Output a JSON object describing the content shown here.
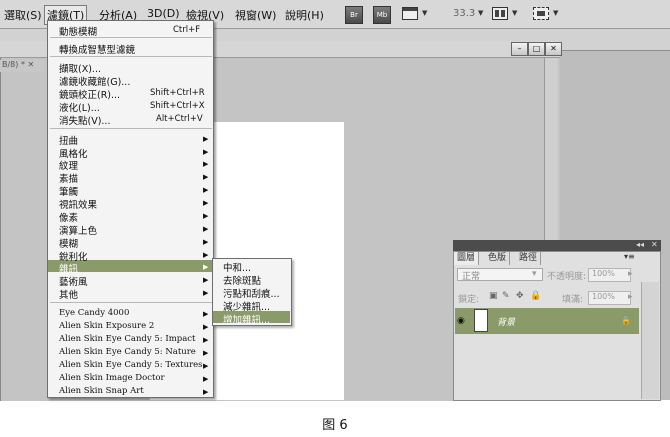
{
  "menubar": {
    "items": [
      "選取(S)",
      "濾鏡(T)",
      "分析(A)",
      "3D(D)",
      "檢視(V)",
      "視窗(W)",
      "說明(H)"
    ],
    "buttons": [
      "Br",
      "Mb"
    ],
    "zoom": "33.3"
  },
  "document": {
    "tab_label": "B/8) * ✕"
  },
  "filter_menu": {
    "last_filter": {
      "label": "動態模糊",
      "shortcut": "Ctrl+F"
    },
    "convert": "轉換成智慧型濾鏡",
    "group1": [
      {
        "label": "擷取(X)...",
        "shortcut": ""
      },
      {
        "label": "濾鏡收藏館(G)...",
        "shortcut": ""
      },
      {
        "label": "鏡頭校正(R)...",
        "shortcut": "Shift+Ctrl+R"
      },
      {
        "label": "液化(L)...",
        "shortcut": "Shift+Ctrl+X"
      },
      {
        "label": "消失點(V)...",
        "shortcut": "Alt+Ctrl+V"
      }
    ],
    "group2": [
      "扭曲",
      "風格化",
      "紋理",
      "素描",
      "筆觸",
      "視訊效果",
      "像素",
      "演算上色",
      "模糊",
      "銳利化",
      "雜訊",
      "藝術風",
      "其他"
    ],
    "group3": [
      "Eye Candy 4000",
      "Alien Skin Exposure 2",
      "Alien Skin Eye Candy 5: Impact",
      "Alien Skin Eye Candy 5: Nature",
      "Alien Skin Eye Candy 5: Textures",
      "Alien Skin Image Doctor",
      "Alien Skin Snap Art"
    ]
  },
  "noise_submenu": {
    "items": [
      "中和...",
      "去除斑點",
      "污點和刮痕...",
      "減少雜訊...",
      "增加雜訊..."
    ]
  },
  "layers_panel": {
    "tabs": [
      "圖層",
      "色版",
      "路徑"
    ],
    "blend_mode": "正常",
    "opacity_label": "不透明度:",
    "opacity_value": "100%",
    "lock_label": "鎖定:",
    "fill_label": "填滿:",
    "fill_value": "100%",
    "layer_name": "背景"
  },
  "caption": "图 6",
  "colors": {
    "highlight": "#8a9a68"
  }
}
